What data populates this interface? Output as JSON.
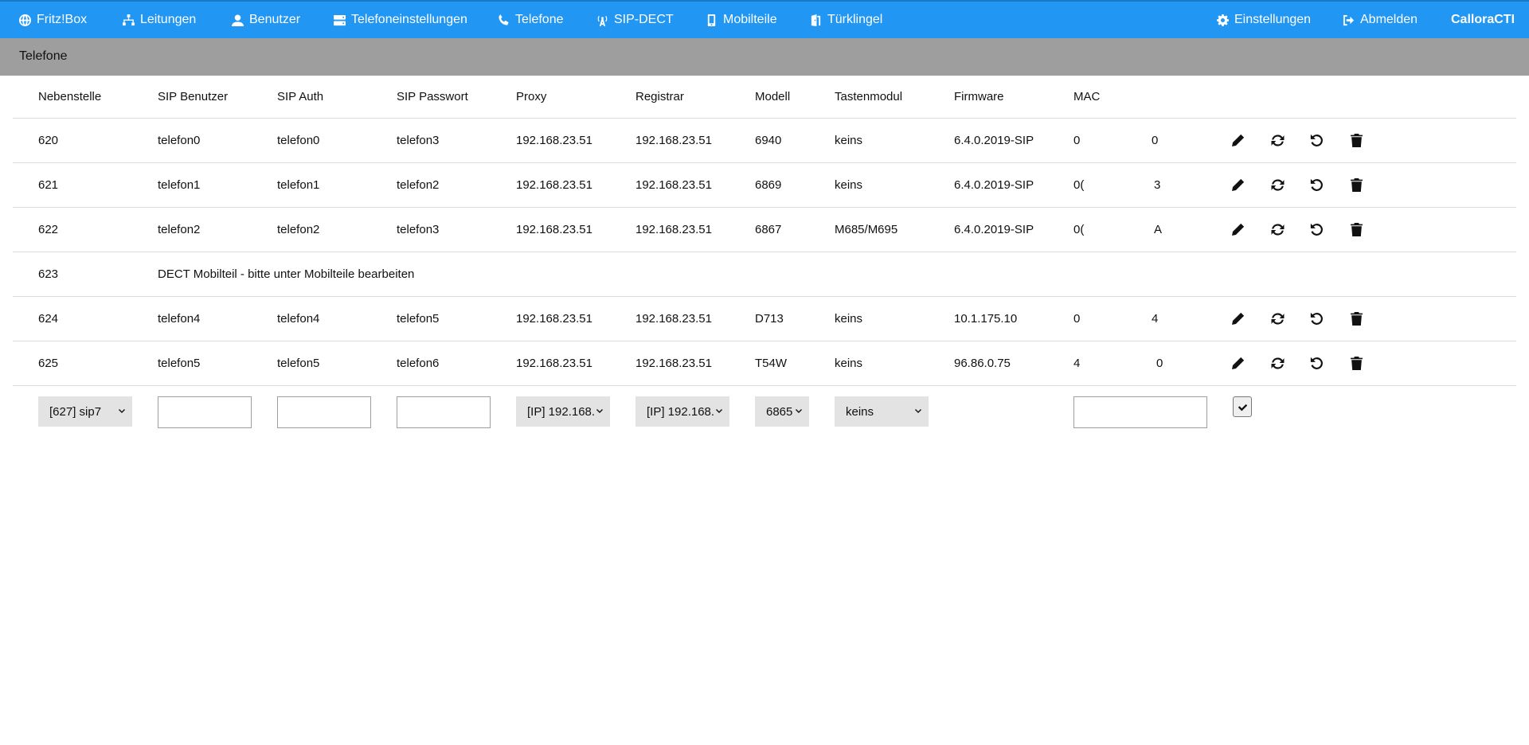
{
  "nav": {
    "items": [
      {
        "label": "Fritz!Box",
        "icon": "globe-icon"
      },
      {
        "label": "Leitungen",
        "icon": "network-icon"
      },
      {
        "label": "Benutzer",
        "icon": "user-icon"
      },
      {
        "label": "Telefoneinstellungen",
        "icon": "server-icon"
      },
      {
        "label": "Telefone",
        "icon": "phone-icon"
      },
      {
        "label": "SIP-DECT",
        "icon": "antenna-icon"
      },
      {
        "label": "Mobilteile",
        "icon": "mobile-icon"
      },
      {
        "label": "Türklingel",
        "icon": "door-icon"
      }
    ],
    "right": [
      {
        "label": "Einstellungen",
        "icon": "gear-icon"
      },
      {
        "label": "Abmelden",
        "icon": "logout-icon"
      }
    ],
    "brand": "CalloraCTI"
  },
  "subheader": {
    "title": "Telefone"
  },
  "table": {
    "columns": [
      "Nebenstelle",
      "SIP Benutzer",
      "SIP Auth",
      "SIP Passwort",
      "Proxy",
      "Registrar",
      "Modell",
      "Tastenmodul",
      "Firmware",
      "MAC"
    ],
    "rows": [
      {
        "ext": "620",
        "sip_user": "telefon0",
        "sip_auth": "telefon0",
        "sip_pass": "telefon3",
        "proxy": "192.168.23.51",
        "registrar": "192.168.23.51",
        "model": "6940",
        "module": "keins",
        "firmware": "6.4.0.2019-SIP",
        "mac_a": "0",
        "mac_b": "0"
      },
      {
        "ext": "621",
        "sip_user": "telefon1",
        "sip_auth": "telefon1",
        "sip_pass": "telefon2",
        "proxy": "192.168.23.51",
        "registrar": "192.168.23.51",
        "model": "6869",
        "module": "keins",
        "firmware": "6.4.0.2019-SIP",
        "mac_a": "0(",
        "mac_b": "3"
      },
      {
        "ext": "622",
        "sip_user": "telefon2",
        "sip_auth": "telefon2",
        "sip_pass": "telefon3",
        "proxy": "192.168.23.51",
        "registrar": "192.168.23.51",
        "model": "6867",
        "module": "M685/M695",
        "firmware": "6.4.0.2019-SIP",
        "mac_a": "0(",
        "mac_b": "A"
      },
      {
        "ext": "623",
        "dect_note": "DECT Mobilteil - bitte unter Mobilteile bearbeiten"
      },
      {
        "ext": "624",
        "sip_user": "telefon4",
        "sip_auth": "telefon4",
        "sip_pass": "telefon5",
        "proxy": "192.168.23.51",
        "registrar": "192.168.23.51",
        "model": "D713",
        "module": "keins",
        "firmware": "10.1.175.10",
        "mac_a": "0",
        "mac_b": "4"
      },
      {
        "ext": "625",
        "sip_user": "telefon5",
        "sip_auth": "telefon5",
        "sip_pass": "telefon6",
        "proxy": "192.168.23.51",
        "registrar": "192.168.23.51",
        "model": "T54W",
        "module": "keins",
        "firmware": "96.86.0.75",
        "mac_a": "4",
        "mac_b": "0"
      }
    ],
    "actions": [
      "edit-icon",
      "sync-icon",
      "reset-icon",
      "delete-icon"
    ]
  },
  "new_row": {
    "extension_select": "[627] sip7",
    "sip_user": "",
    "sip_auth": "",
    "sip_pass": "",
    "proxy_select": "[IP] 192.168.",
    "registrar_select": "[IP] 192.168.",
    "model_select": "6865",
    "module_select": "keins",
    "mac": ""
  },
  "colors": {
    "nav": "#2196f3",
    "subheader": "#9e9e9e",
    "select_bg": "#e3e3e3"
  }
}
